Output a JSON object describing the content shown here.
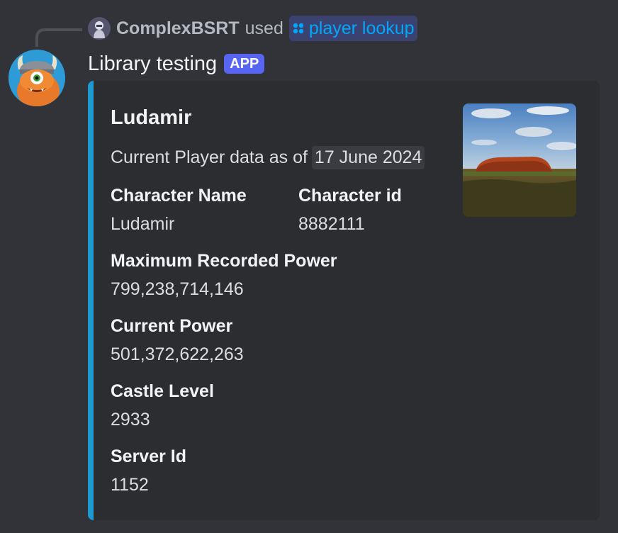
{
  "interaction": {
    "user": "ComplexBSRT",
    "used_text": "used",
    "command": "player lookup",
    "command_icon": "slash-command-icon"
  },
  "message": {
    "author": "Library testing",
    "badge": "APP"
  },
  "embed": {
    "accent_color": "#1d9bd1",
    "title": "Ludamir",
    "description_prefix": "Current Player data as of",
    "description_date": "17 June 2024",
    "fields": [
      {
        "name": "Character Name",
        "value": "Ludamir"
      },
      {
        "name": "Character id",
        "value": "8882111"
      },
      {
        "name": "Maximum Recorded Power",
        "value": "799,238,714,146"
      },
      {
        "name": "Current Power",
        "value": "501,372,622,263"
      },
      {
        "name": "Castle Level",
        "value": "2933"
      },
      {
        "name": "Server Id",
        "value": "1152"
      }
    ]
  }
}
